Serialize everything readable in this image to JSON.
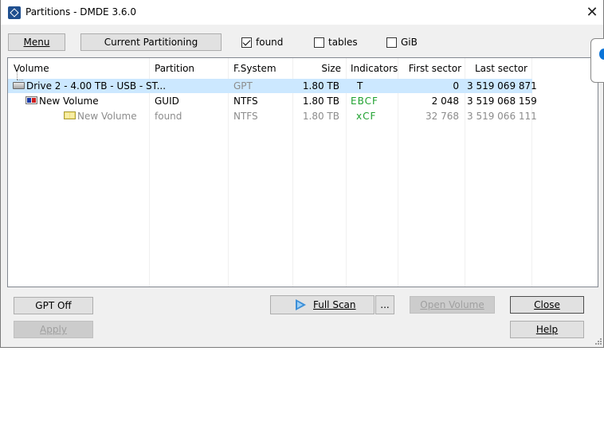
{
  "window": {
    "title": "Partitions - DMDE 3.6.0"
  },
  "toolbar": {
    "menu_label": "Menu",
    "current_partitioning_label": "Current Partitioning",
    "found": {
      "label": "found",
      "checked": true
    },
    "tables": {
      "label": "tables",
      "checked": false
    },
    "gib": {
      "label": "GiB",
      "checked": false
    }
  },
  "table": {
    "columns": [
      "Volume",
      "Partition",
      "F.System",
      "Size",
      "Indicators",
      "First sector",
      "Last sector"
    ],
    "rows": [
      {
        "volume": "Drive 2 - 4.00 TB - USB - ST...",
        "partition": "",
        "fsystem": "GPT",
        "size": "1.80 TB",
        "indicators": "T",
        "first_sector": "0",
        "last_sector": "3 519 069 871"
      },
      {
        "volume": "New Volume",
        "partition": "GUID",
        "fsystem": "NTFS",
        "size": "1.80 TB",
        "indicators": "EBCF",
        "first_sector": "2 048",
        "last_sector": "3 519 068 159"
      },
      {
        "volume": "New Volume",
        "partition": "found",
        "fsystem": "NTFS",
        "size": "1.80 TB",
        "indicators": "xCF",
        "first_sector": "32 768",
        "last_sector": "3 519 066 111"
      }
    ]
  },
  "buttons": {
    "gpt_off": "GPT Off",
    "apply": "Apply",
    "full_scan": "Full Scan",
    "more": "...",
    "open_volume": "Open Volume",
    "close": "Close",
    "help": "Help"
  },
  "colors": {
    "selection": "#cce8ff",
    "indicator_green": "#1fa12f",
    "accent": "#0078d7"
  }
}
